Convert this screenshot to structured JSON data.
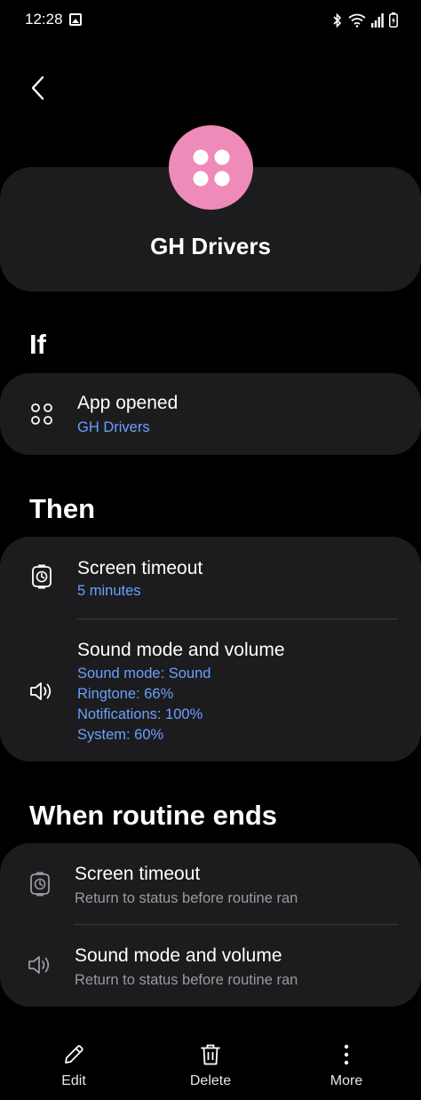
{
  "status_bar": {
    "time": "12:28"
  },
  "header": {
    "title": "GH Drivers",
    "badge_color": "#ef8bb8"
  },
  "if_section": {
    "title": "If",
    "condition": {
      "title": "App opened",
      "value": "GH Drivers"
    }
  },
  "then_section": {
    "title": "Then",
    "actions": [
      {
        "title": "Screen timeout",
        "details": [
          "5 minutes"
        ]
      },
      {
        "title": "Sound mode and volume",
        "details": [
          "Sound mode: Sound",
          "Ringtone: 66%",
          "Notifications: 100%",
          "System: 60%"
        ]
      }
    ]
  },
  "ends_section": {
    "title": "When routine ends",
    "actions": [
      {
        "title": "Screen timeout",
        "detail": "Return to status before routine ran"
      },
      {
        "title": "Sound mode and volume",
        "detail": "Return to status before routine ran"
      }
    ]
  },
  "bottom_bar": {
    "edit_label": "Edit",
    "delete_label": "Delete",
    "more_label": "More"
  },
  "colors": {
    "background": "#000000",
    "card": "#1c1c1e",
    "accent_text": "#6aa0ff",
    "secondary_text": "#9a9a9f"
  }
}
